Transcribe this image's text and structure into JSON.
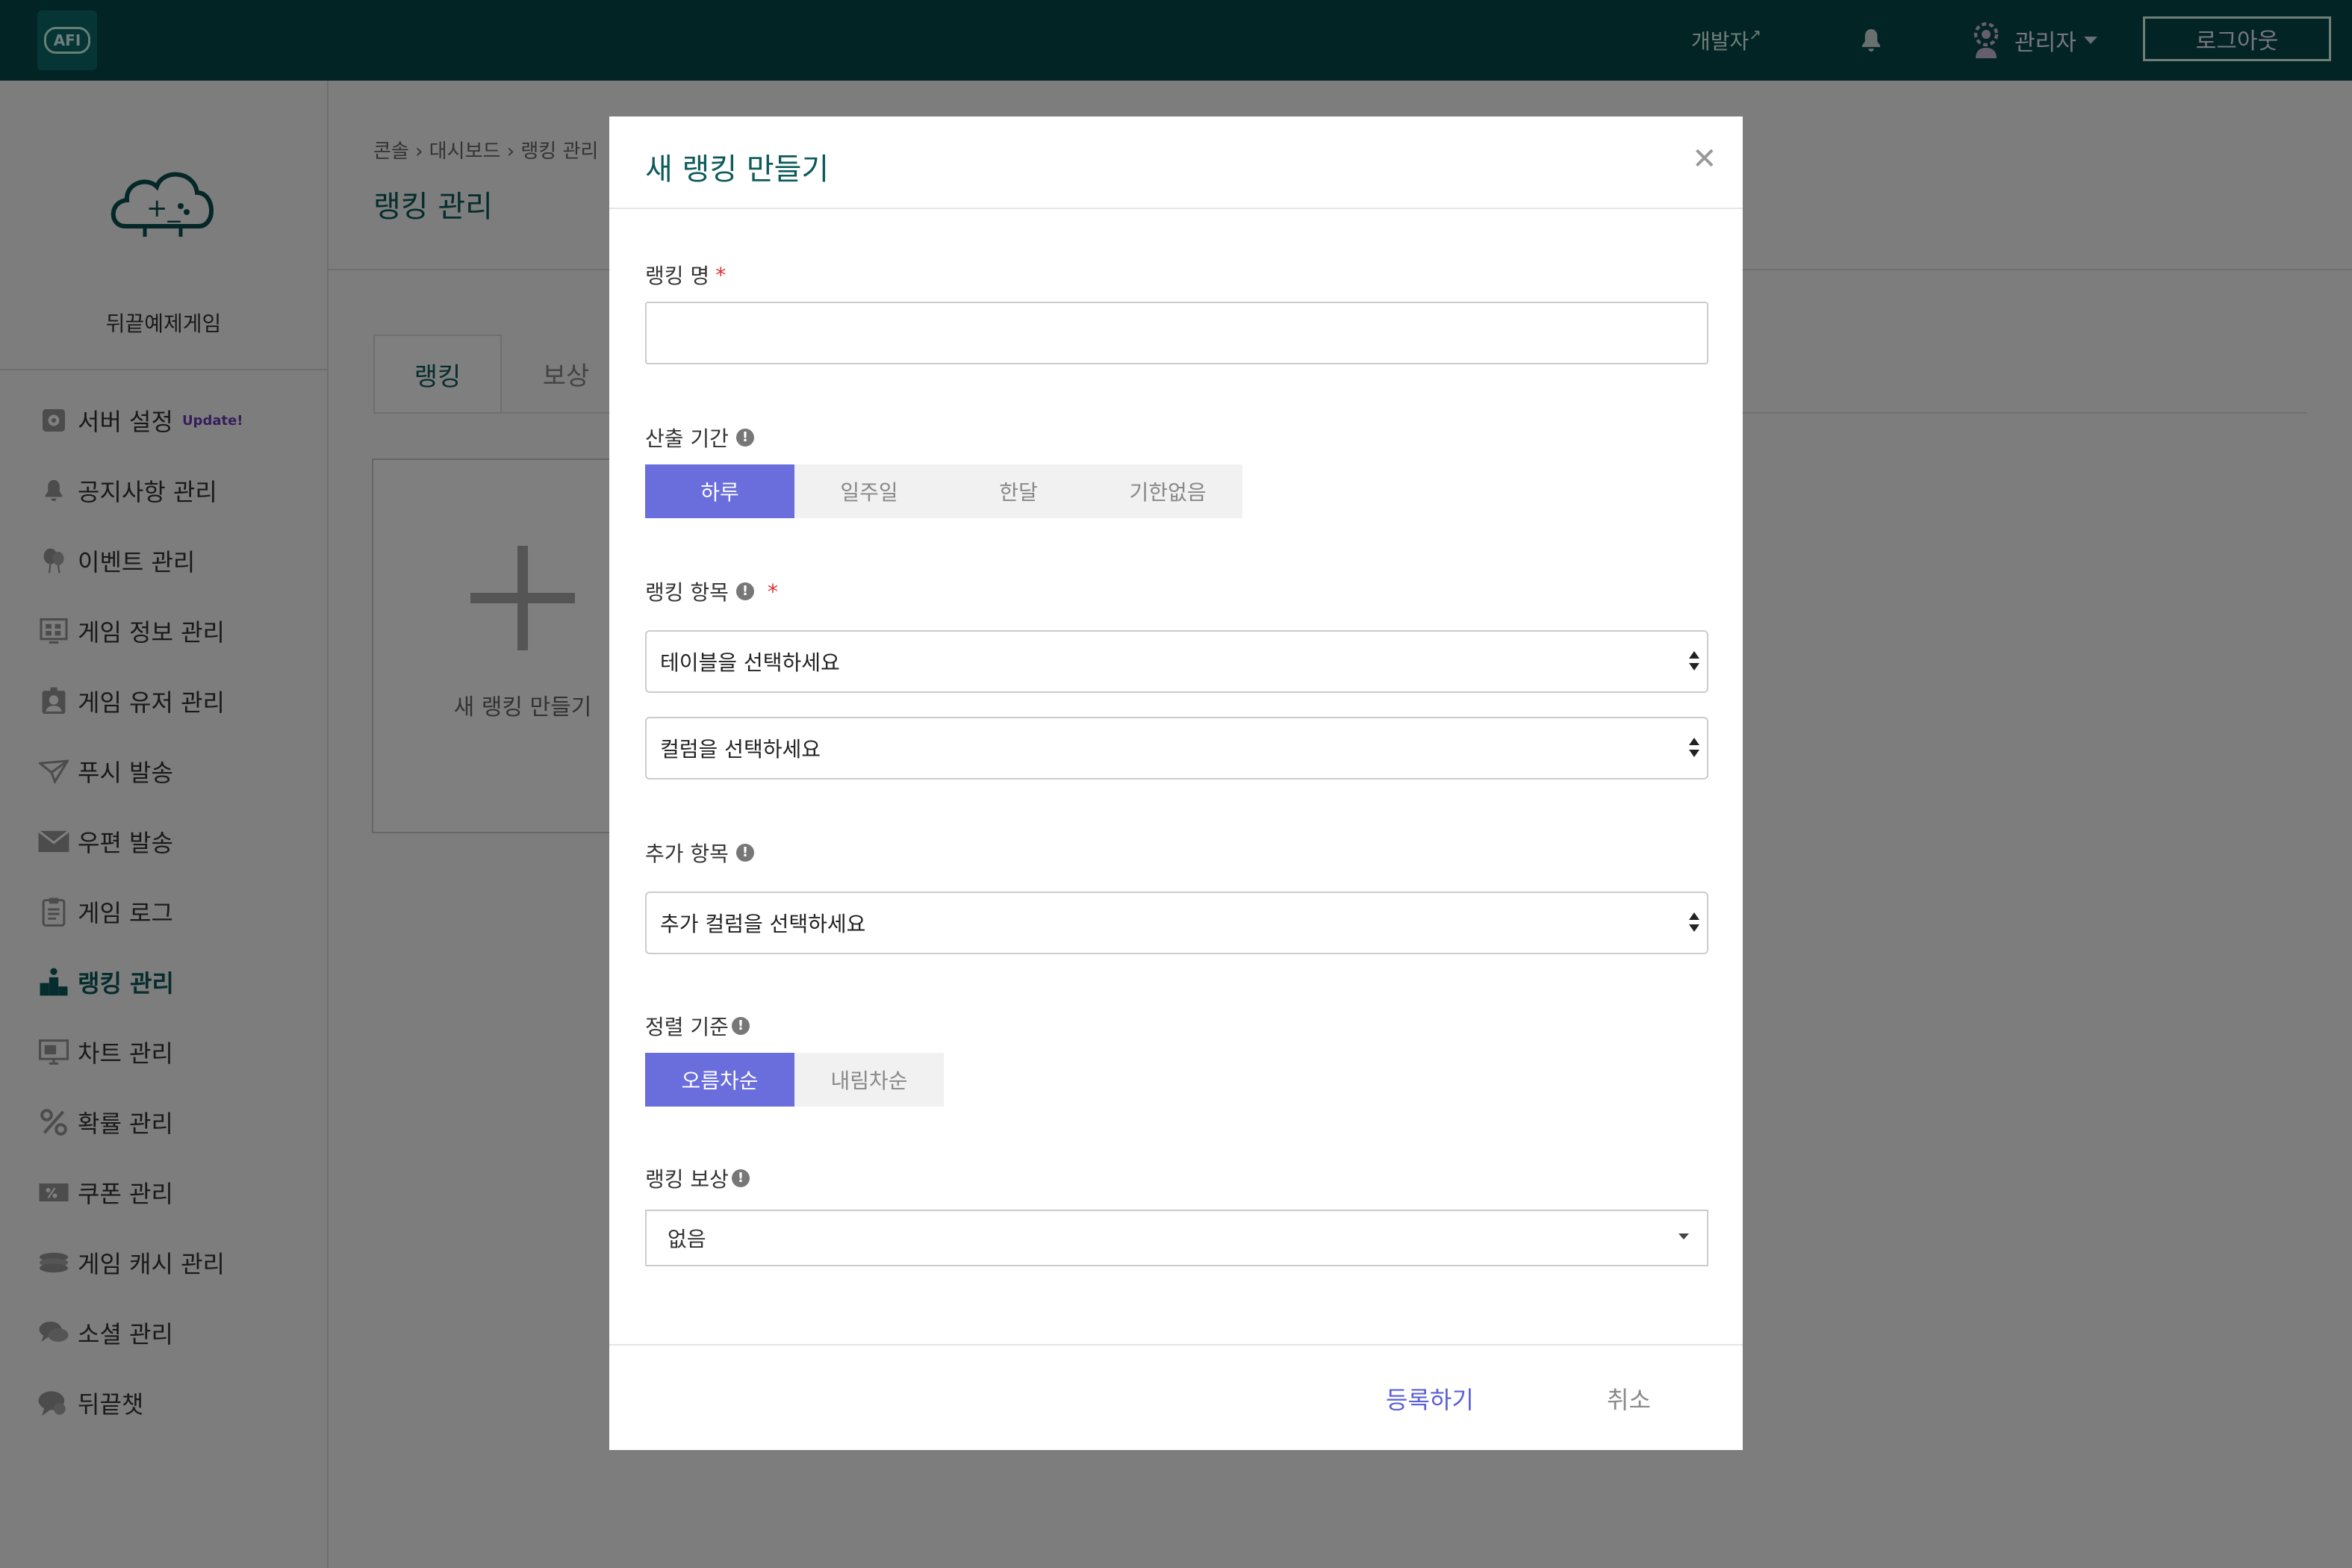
{
  "topbar": {
    "logo_text": "AFI",
    "developer": "개발자",
    "admin": "관리자",
    "logout": "로그아웃"
  },
  "sidebar": {
    "game_name": "뒤끝예제게임",
    "items": [
      {
        "label": "서버 설정",
        "badge": "Update!",
        "icon": "gear-icon"
      },
      {
        "label": "공지사항 관리",
        "icon": "bell-icon"
      },
      {
        "label": "이벤트 관리",
        "icon": "balloon-icon"
      },
      {
        "label": "게임 정보 관리",
        "icon": "grid-icon"
      },
      {
        "label": "게임 유저 관리",
        "icon": "user-badge-icon"
      },
      {
        "label": "푸시 발송",
        "icon": "send-icon"
      },
      {
        "label": "우편 발송",
        "icon": "mail-icon"
      },
      {
        "label": "게임 로그",
        "icon": "clipboard-icon"
      },
      {
        "label": "랭킹 관리",
        "icon": "podium-icon",
        "active": true
      },
      {
        "label": "차트 관리",
        "icon": "chart-icon"
      },
      {
        "label": "확률 관리",
        "icon": "percent-icon"
      },
      {
        "label": "쿠폰 관리",
        "icon": "coupon-icon"
      },
      {
        "label": "게임 캐시 관리",
        "icon": "coins-icon"
      },
      {
        "label": "소셜 관리",
        "icon": "chat-icon"
      },
      {
        "label": "뒤끝챗",
        "icon": "chat-bubble-icon"
      }
    ]
  },
  "main": {
    "breadcrumb": "콘솔 › 대시보드 › 랭킹 관리",
    "title": "랭킹 관리",
    "tabs": [
      "랭킹",
      "보상"
    ],
    "new_card_label": "새 랭킹 만들기"
  },
  "modal": {
    "title": "새 랭킹 만들기",
    "name_label": "랭킹 명",
    "name_value": "",
    "period_label": "산출 기간",
    "period_options": [
      "하루",
      "일주일",
      "한달",
      "기한없음"
    ],
    "period_selected": "하루",
    "item_label": "랭킹 항목",
    "table_select": "테이블을 선택하세요",
    "column_select": "컬럼을 선택하세요",
    "extra_label": "추가 항목",
    "extra_select": "추가 컬럼을 선택하세요",
    "sort_label": "정렬 기준",
    "sort_options": [
      "오름차순",
      "내림차순"
    ],
    "sort_selected": "오름차순",
    "reward_label": "랭킹 보상",
    "reward_value": "없음",
    "submit": "등록하기",
    "cancel": "취소"
  },
  "colors": {
    "topbar": "#06494a",
    "accent": "#6a6ddc",
    "title": "#0d5a5a"
  }
}
